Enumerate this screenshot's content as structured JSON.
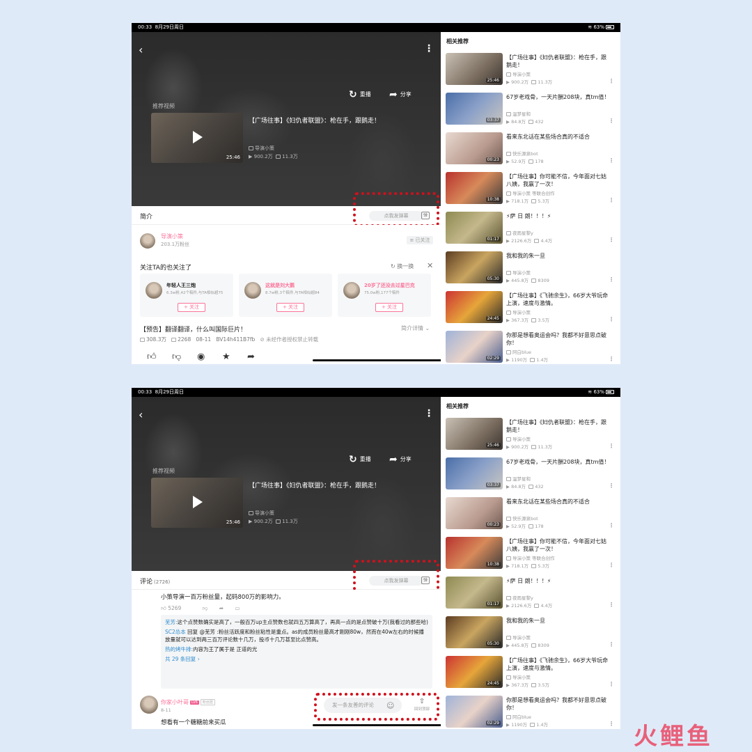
{
  "status": {
    "time": "00:33",
    "date": "8月29日周日",
    "battery": "63%"
  },
  "player": {
    "replay": "重播",
    "share": "分享",
    "recommend_label": "推荐视频",
    "rec_title": "【广场往事】《妇仇者联盟》：枪在手，跟鹅走！",
    "rec_duration": "25:46",
    "rec_up": "导演小策",
    "rec_views": "900.2万",
    "rec_danmaku": "11.3万"
  },
  "danmaku": {
    "placeholder": "点我发弹幕",
    "icon": "弹"
  },
  "top": {
    "tab": "简介",
    "up_name": "导演小策",
    "up_fans": "203.1万粉丝",
    "followed": "≡ 已关注",
    "also_follow_title": "关注TA的也关注了",
    "swap": "换一换",
    "cards": [
      {
        "name": "年轻人王三炮",
        "desc": "6.3w粉,42个稿件,与TA相似超75",
        "btn": "+ 关注"
      },
      {
        "name": "这就是刘大鹅",
        "desc": "8.7w粉,3个稿件,与TA相似超84",
        "btn": "+ 关注"
      },
      {
        "name": "20岁了还没去过星巴克",
        "desc": "75.0w粉,177个稿件",
        "btn": "+ 关注"
      }
    ],
    "video_title": "【预告】翻译翻译，什么叫国际巨片！",
    "detail": "简介详情",
    "views": "308.3万",
    "danmaku_count": "2268",
    "date": "08-11",
    "bvid": "BV14h411B7fb",
    "warning": "未经作者授权禁止转载"
  },
  "bottom": {
    "tab": "评论",
    "comment_count": "(2726)",
    "first_comment": "小策导演一百万粉丝量，起码800万的影响力。",
    "likes": "5269",
    "replies": [
      {
        "name": "芜芳:",
        "text": "这个点赞数确实是高了，一般百万up主点赞数也就四五万算高了，再高一点的是点赞破十万(我看过的那些哈)"
      },
      {
        "name": "SC2怂本",
        "text": "回复 @芜芳 :粉丝活跃度和粉丝粘性是重点。as的成员粉丝最高才刚刚80w，然而在40w左右的时候播放量就可以达到两三百万评论数十几万，投币十几万甚至比点赞高。"
      },
      {
        "name": "热的烤牛排:",
        "text": "内容为王了属于是 正道的光"
      }
    ],
    "all_replies": "共 29 条回复 ›",
    "c2_name": "你家小叶哥",
    "c2_level": "LV6",
    "c2_tag": "粉丝团",
    "c2_date": "8-11",
    "c2_text": "想看有一个糖糖前来买瓜",
    "input_placeholder": "发一条友善的评论",
    "top_label": "回到顶部"
  },
  "related": {
    "title": "相关推荐",
    "items": [
      {
        "title": "【广场往事】《妇仇者联盟》：枪在手，跟鹅走！",
        "duration": "25:46",
        "up": "导演小策",
        "views": "900.2万",
        "danmaku": "11.3万"
      },
      {
        "title": "67岁老戏骨，一天片酬208块，真tm值！",
        "duration": "03:37",
        "up": "温梦星和",
        "views": "84.8万",
        "danmaku": "432"
      },
      {
        "title": "看来东北话在某些场合真的不适合",
        "duration": "00:23",
        "up": "快乐源泉bot",
        "views": "52.9万",
        "danmaku": "178"
      },
      {
        "title": "【广场往事】你可能不信，今年面对七姑八姨，我赢了一次！",
        "duration": "10:38",
        "up": "导演小策 等联合创作",
        "views": "718.1万",
        "danmaku": "5.3万"
      },
      {
        "title": "⚡萨 日 朗！！！⚡",
        "duration": "01:17",
        "up": "夜雨星黎y",
        "views": "2126.6万",
        "danmaku": "4.4万"
      },
      {
        "title": "我和我的朱一旦",
        "duration": "05:30",
        "up": "导演小策",
        "views": "445.8万",
        "danmaku": "8309"
      },
      {
        "title": "【广场往事】《飞驰余生》，66岁大爷玩命上演，速度与激情。",
        "duration": "24:45",
        "up": "导演小策",
        "views": "367.3万",
        "danmaku": "3.5万"
      },
      {
        "title": "你那是想看奥运会吗？我都不好意思点破你！",
        "duration": "02:29",
        "up": "阿白blue",
        "views": "1190万",
        "danmaku": "1.4万"
      }
    ]
  },
  "watermark": "火鲤鱼"
}
